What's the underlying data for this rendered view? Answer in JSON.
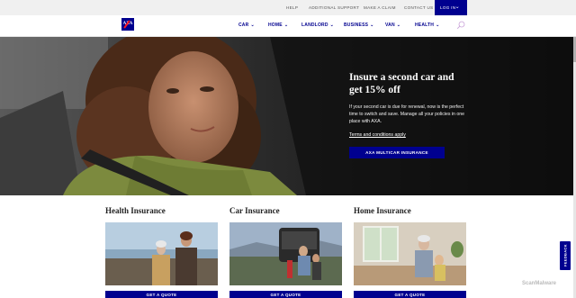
{
  "utility_bar": {
    "links": [
      "HELP",
      "ADDITIONAL SUPPORT",
      "MAKE A CLAIM",
      "CONTACT US"
    ],
    "login_label": "LOG IN"
  },
  "nav": {
    "logo_text": "AXA",
    "items": [
      "CAR",
      "HOME",
      "LANDLORD",
      "BUSINESS",
      "VAN",
      "HEALTH"
    ]
  },
  "hero": {
    "title": "Insure a second car and get 15% off",
    "body": "If your second car is due for renewal, now is the perfect time to switch and save. Manage all your policies in one place with AXA.",
    "terms_link": "Terms and conditions apply",
    "cta_label": "AXA MULTICAR INSURANCE"
  },
  "cards": [
    {
      "title": "Health Insurance",
      "button_label": "GET A QUOTE"
    },
    {
      "title": "Car Insurance",
      "button_label": "GET A QUOTE"
    },
    {
      "title": "Home Insurance",
      "button_label": "GET A QUOTE"
    }
  ],
  "feedback_label": "FEEDBACK",
  "watermark": "ScanMalware",
  "colors": {
    "brand_blue": "#00008f",
    "brand_red": "#ff1721",
    "utility_bg": "#f0f0f0"
  },
  "icons": [
    "chevron-down-icon",
    "search-icon",
    "axa-logo"
  ]
}
